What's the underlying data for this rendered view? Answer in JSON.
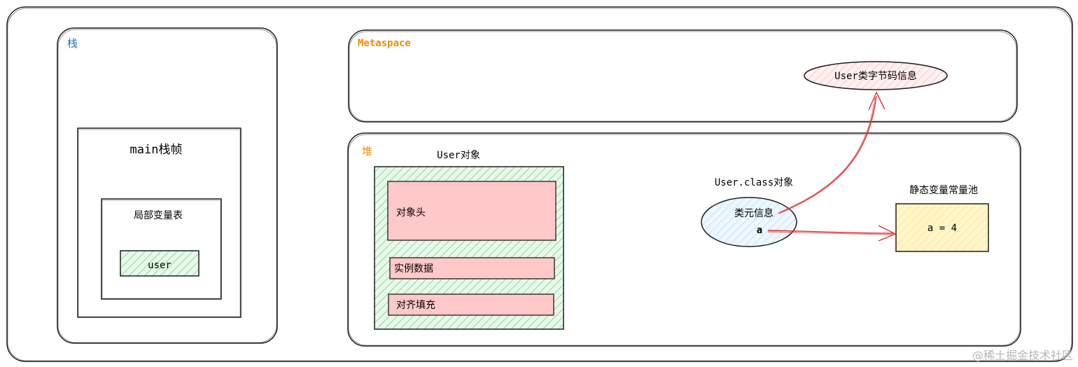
{
  "stack": {
    "title": "栈",
    "frame_title": "main栈帧",
    "locals_title": "局部变量表",
    "var_name": "user"
  },
  "metaspace": {
    "title": "Metaspace",
    "bytecode_label": "User类字节码信息"
  },
  "heap": {
    "title": "堆",
    "user_object": {
      "title": "User对象",
      "header": "对象头",
      "instance_data": "实例数据",
      "padding": "对齐填充"
    },
    "class_object": {
      "title": "User.class对象",
      "meta_label": "类元信息",
      "field_a": "a"
    },
    "static_pool": {
      "title": "静态变量常量池",
      "value": "a = 4"
    }
  },
  "watermark": "@稀土掘金技术社区",
  "colors": {
    "title_blue": "#1971c2",
    "title_orange": "#f08c00",
    "arrow_red": "#e03131",
    "fill_green": "#b2f2bb",
    "fill_pink": "#ffc9c9",
    "fill_blue": "#a5d8ff",
    "fill_yellow": "#ffec99"
  }
}
